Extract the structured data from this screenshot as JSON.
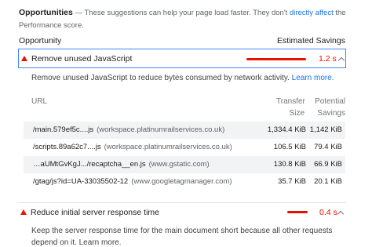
{
  "header": {
    "title": "Opportunities",
    "text_before_link": " — These suggestions can help your page load faster. They don't ",
    "link": "directly affect",
    "text_after_link": " the Performance score."
  },
  "table_head": {
    "left": "Opportunity",
    "right": "Estimated Savings"
  },
  "audits": [
    {
      "title": "Remove unused JavaScript",
      "savings": "1.2 s",
      "description": "Remove unused JavaScript to reduce bytes consumed by network activity. ",
      "learn_more": "Learn more."
    },
    {
      "title": "Reduce initial server response time",
      "savings": "0.4 s",
      "description": "Keep the server response time for the main document short because all other requests depend on it. ",
      "learn_more": "Learn more."
    }
  ],
  "url_table": {
    "headers": {
      "url": "URL",
      "transfer_1": "Transfer",
      "transfer_2": "Size",
      "potential_1": "Potential",
      "potential_2": "Savings"
    },
    "rows": [
      {
        "url": "/main.579ef5c....js",
        "host": "(workspace.platinumrailservices.co.uk)",
        "transfer": "1,334.4 KiB",
        "savings": "1,142 KiB"
      },
      {
        "url": "/scripts.89a62c7....js",
        "host": "(workspace.platinumrailservices.co.uk)",
        "transfer": "106.5 KiB",
        "savings": "79.4 KiB"
      },
      {
        "url": "…aUMtGvKgJ.../recaptcha__en.js",
        "host": "(www.gstatic.com)",
        "transfer": "130.8 KiB",
        "savings": "66.9 KiB"
      },
      {
        "url": "/gtag/js?id=UA-33035502-12",
        "host": "(www.googletagmanager.com)",
        "transfer": "35.7 KiB",
        "savings": "20.1 KiB"
      }
    ]
  },
  "colors": {
    "fail": "#eb0f00",
    "link": "#1a73e8",
    "focus_border": "#4285f4"
  },
  "icons": {
    "fail": "warning-triangle-icon",
    "expand": "chevron-up-icon"
  }
}
